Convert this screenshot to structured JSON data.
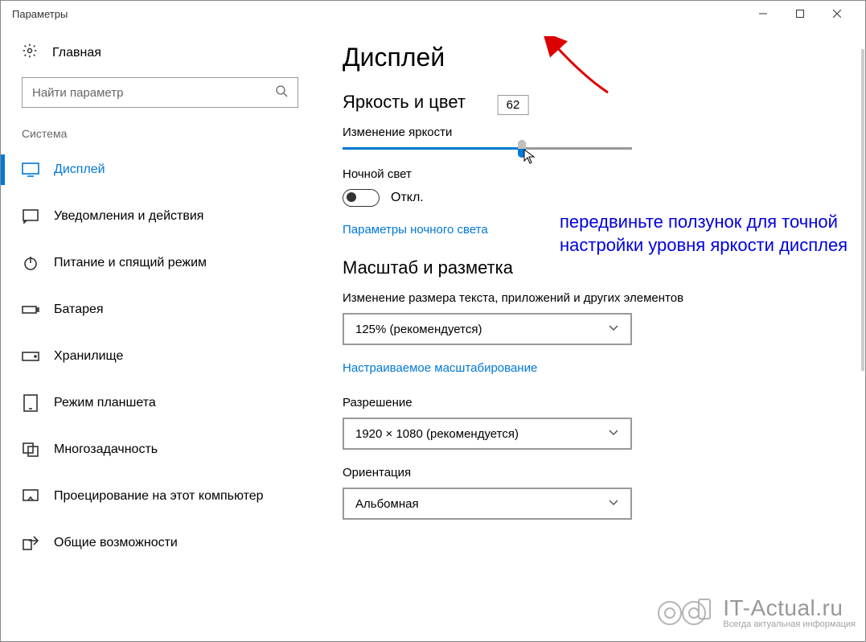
{
  "window": {
    "title": "Параметры"
  },
  "sidebar": {
    "home": "Главная",
    "search_placeholder": "Найти параметр",
    "section": "Система",
    "items": [
      {
        "label": "Дисплей"
      },
      {
        "label": "Уведомления и действия"
      },
      {
        "label": "Питание и спящий режим"
      },
      {
        "label": "Батарея"
      },
      {
        "label": "Хранилище"
      },
      {
        "label": "Режим планшета"
      },
      {
        "label": "Многозадачность"
      },
      {
        "label": "Проецирование на этот компьютер"
      },
      {
        "label": "Общие возможности"
      }
    ]
  },
  "main": {
    "title": "Дисплей",
    "brightness_section": "Яркость и цвет",
    "brightness_label": "Изменение яркости",
    "brightness_value": "62",
    "brightness_percent": 62,
    "night_light_label": "Ночной свет",
    "night_light_state": "Откл.",
    "night_light_link": "Параметры ночного света",
    "scale_section": "Масштаб и разметка",
    "scale_label": "Изменение размера текста, приложений и других элементов",
    "scale_value": "125% (рекомендуется)",
    "scale_link": "Настраиваемое масштабирование",
    "resolution_label": "Разрешение",
    "resolution_value": "1920 × 1080 (рекомендуется)",
    "orientation_label": "Ориентация",
    "orientation_value": "Альбомная"
  },
  "annotation": {
    "text": "передвиньте ползунок для точной настройки уровня яркости дисплея"
  },
  "watermark": {
    "main": "IT-Actual.ru",
    "sub": "Всегда актуальная информация"
  }
}
